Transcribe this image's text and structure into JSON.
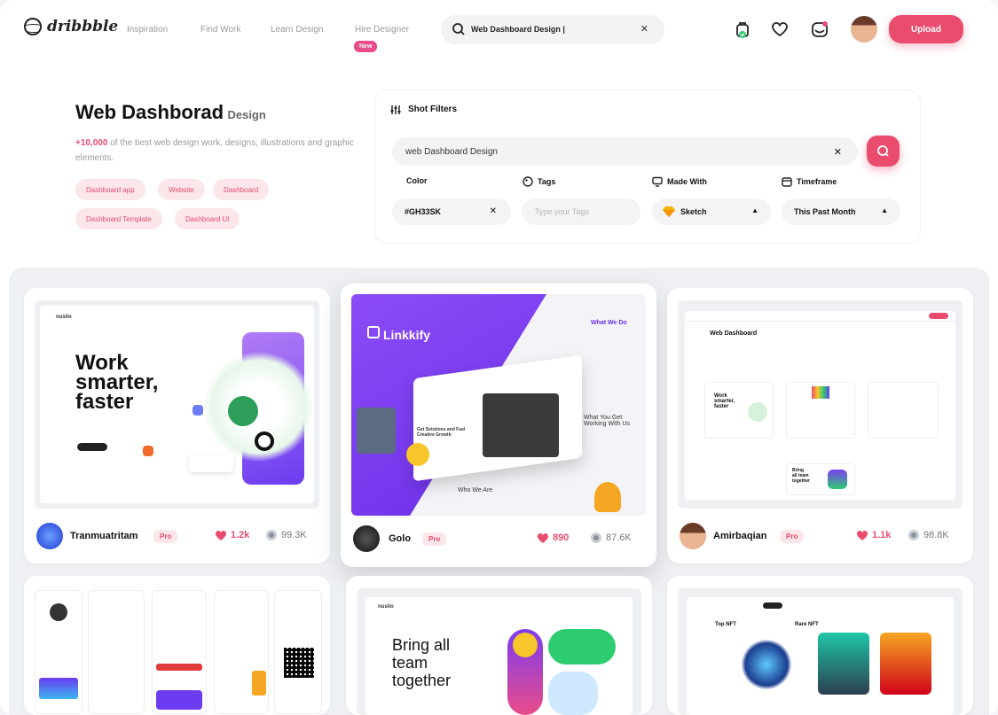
{
  "nav": {
    "logo": "dribbble",
    "links": [
      "Inspiration",
      "Find Work",
      "Learn Design",
      "Hire Designer"
    ],
    "new_badge": "New",
    "search_value": "Web Dashboard Design |",
    "upload": "Upload"
  },
  "header": {
    "title": "Web Dashborad",
    "title_suffix": "Design",
    "count": "+10,000",
    "desc": " of the best web design work, designs, illustrations and graphic elements.",
    "chips": [
      "Dashboard app",
      "Website",
      "Dashboard",
      "Dashboard Template",
      "Dashboard UI"
    ]
  },
  "filters": {
    "heading": "Shot Filters",
    "query": "web Dashboard Design",
    "labels": {
      "color": "Color",
      "tags": "Tags",
      "made_with": "Made With",
      "timeframe": "Timeframe"
    },
    "color_value": "#GH33SK",
    "tags_placeholder": "Type your Tags",
    "made_with_value": "Sketch",
    "timeframe_value": "This Past Month"
  },
  "shots": [
    {
      "author": "Tranmuatritam",
      "badge": "Pro",
      "likes": "1.2k",
      "views": "99.3K",
      "thumb": {
        "brand": "nuslio",
        "headline": [
          "Work",
          "smarter,",
          "faster"
        ]
      }
    },
    {
      "author": "Golo",
      "badge": "Pro",
      "likes": "890",
      "views": "87.6K",
      "thumb": {
        "brand": "Linkkify",
        "tagline": "What We Do",
        "text_a": "Get Solutions and Fuel Creative Growth",
        "text_b": "What You Get Working With Us",
        "text_c": "Who We Are"
      }
    },
    {
      "author": "Amirbaqian",
      "badge": "Pro",
      "likes": "1.1k",
      "views": "98.8K",
      "thumb": {
        "title": "Web Dashboard",
        "mini_a": [
          "Work",
          "smarter,",
          "faster"
        ],
        "mini_b": [
          "Bring",
          "all team",
          "together"
        ]
      }
    },
    {
      "thumb": {}
    },
    {
      "thumb": {
        "brand": "nuslio",
        "headline": [
          "Bring all",
          "team",
          "together"
        ]
      }
    },
    {
      "thumb": {
        "labels": [
          "Top NFT",
          "Rare NFT"
        ]
      }
    }
  ],
  "colors": {
    "accent": "#ea4c6e",
    "pink_soft": "#fbe6ea",
    "purple": "#7b3cf0"
  }
}
